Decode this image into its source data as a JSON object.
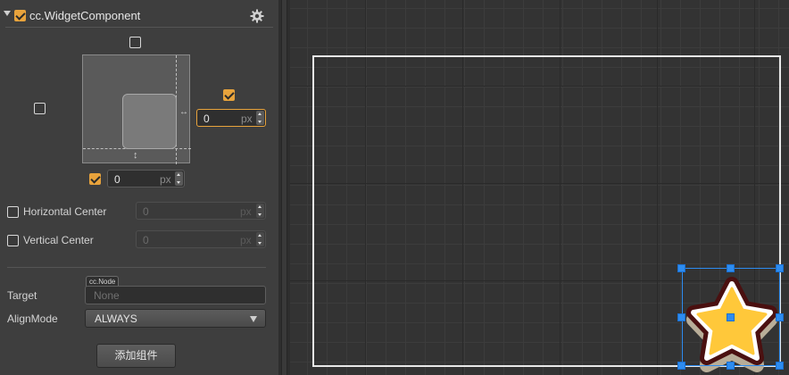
{
  "component": {
    "title": "cc.WidgetComponent",
    "enabled": true,
    "settings_icon": "gear-icon",
    "collapse_icon": "triangle-down-icon"
  },
  "widget": {
    "align_top": false,
    "align_left": false,
    "align_right": true,
    "align_bottom": true,
    "right_value": "0",
    "right_unit": "px",
    "bottom_value": "0",
    "bottom_unit": "px"
  },
  "horizontal_center": {
    "label": "Horizontal Center",
    "checked": false,
    "value": "0",
    "unit": "px"
  },
  "vertical_center": {
    "label": "Vertical Center",
    "checked": false,
    "value": "0",
    "unit": "px"
  },
  "target": {
    "label": "Target",
    "type_tag": "cc.Node",
    "placeholder": "None"
  },
  "align_mode": {
    "label": "AlignMode",
    "value": "ALWAYS"
  },
  "add_component_label": "添加组件",
  "colors": {
    "accent": "#e8a33c",
    "selection": "#2d8cf0",
    "panel": "#3e3e3e",
    "scene": "#333333"
  }
}
